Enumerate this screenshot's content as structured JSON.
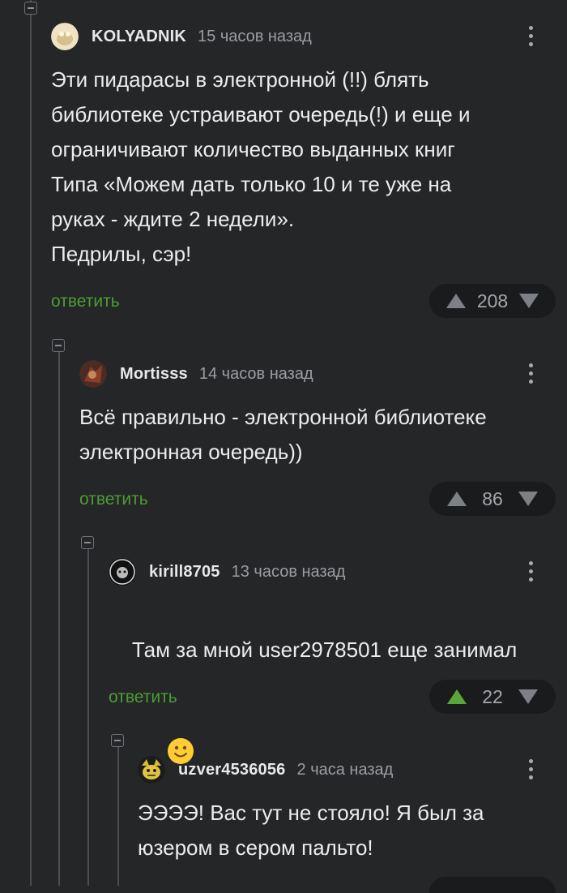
{
  "colors": {
    "background": "#242628",
    "reply_link": "#4d9c33",
    "vote_up_active": "#5aa53b",
    "thread_line": "#4a4d51"
  },
  "comments": [
    {
      "username": "KOLYADNIK",
      "time": "15 часов назад",
      "text": "Эти пидарасы в электронной (!!) блять\nбиблиотеке устраивают очередь(!) и еще и\nограничивают количество выданных книг\nТипа «Можем дать только 10 и те уже на\nруках - ждите 2 недели».\nПедрилы, сэр!",
      "reply_label": "ответить",
      "rating": "208",
      "upvoted": false
    },
    {
      "username": "Mortisss",
      "time": "14 часов назад",
      "text": "Всё правильно - электронной библиотеке\nэлектронная очередь))",
      "reply_label": "ответить",
      "rating": "86",
      "upvoted": false
    },
    {
      "username": "kirill8705",
      "time": "13 часов назад",
      "text": "Там за мной user2978501 еще занимал",
      "emoji": "slightly-smiling-face-emoji",
      "reply_label": "ответить",
      "rating": "22",
      "upvoted": true
    },
    {
      "username": "uzver4536056",
      "time": "2 часа назад",
      "text": "ЭЭЭЭ! Вас тут не стояло! Я был за\nюзером в сером пальто!"
    }
  ]
}
